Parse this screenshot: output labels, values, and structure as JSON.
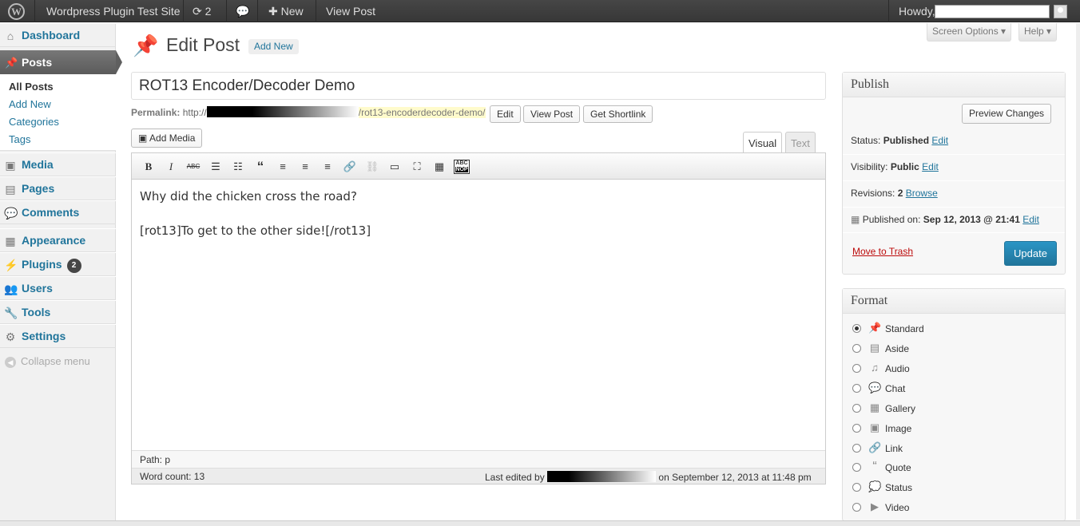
{
  "adminbar": {
    "site_name": "Wordpress Plugin Test Site",
    "updates_count": "2",
    "new_label": "New",
    "view_post_label": "View Post",
    "howdy": "Howdy,"
  },
  "sidebar": {
    "dashboard": "Dashboard",
    "posts": "Posts",
    "submenu": [
      "All Posts",
      "Add New",
      "Categories",
      "Tags"
    ],
    "media": "Media",
    "pages": "Pages",
    "comments": "Comments",
    "appearance": "Appearance",
    "plugins": "Plugins",
    "plugins_badge": "2",
    "users": "Users",
    "tools": "Tools",
    "settings": "Settings",
    "collapse": "Collapse menu"
  },
  "header": {
    "screen_options": "Screen Options ▾",
    "help": "Help ▾",
    "title": "Edit Post",
    "add_new": "Add New"
  },
  "post": {
    "title": "ROT13 Encoder/Decoder Demo",
    "permalink_label": "Permalink:",
    "permalink_prefix": "http://",
    "permalink_slug": "/rot13-encoderdecoder-demo/",
    "edit_btn": "Edit",
    "view_post_btn": "View Post",
    "shortlink_btn": "Get Shortlink",
    "add_media": "Add Media",
    "tab_visual": "Visual",
    "tab_text": "Text",
    "content_line1": "Why did the chicken cross the road?",
    "content_line2": "[rot13]To get to the other side![/rot13]",
    "path": "Path: p",
    "word_count": "Word count: 13",
    "last_edited_by": "Last edited by",
    "last_edited_on": "on September 12, 2013 at 11:48 pm"
  },
  "publish": {
    "title": "Publish",
    "preview": "Preview Changes",
    "status_label": "Status:",
    "status_value": "Published",
    "visibility_label": "Visibility:",
    "visibility_value": "Public",
    "revisions_label": "Revisions:",
    "revisions_value": "2",
    "browse": "Browse",
    "published_on_label": "Published on:",
    "published_on_value": "Sep 12, 2013 @ 21:41",
    "edit": "Edit",
    "trash": "Move to Trash",
    "update": "Update"
  },
  "format": {
    "title": "Format",
    "options": [
      "Standard",
      "Aside",
      "Audio",
      "Chat",
      "Gallery",
      "Image",
      "Link",
      "Quote",
      "Status",
      "Video"
    ],
    "selected": "Standard"
  }
}
